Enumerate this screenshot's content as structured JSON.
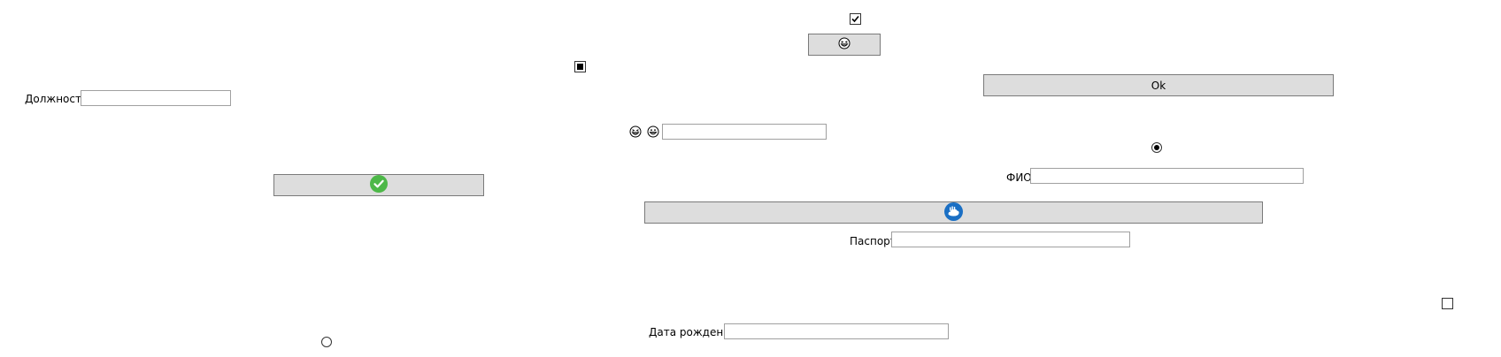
{
  "form": {
    "position_label": "Должность",
    "fio_label": "ФИО",
    "passport_label": "Паспорт",
    "birthdate_label": "Дата рождения",
    "ok_button_label": "Ok",
    "position_value": "",
    "fio_value": "",
    "passport_value": "",
    "birthdate_value": "",
    "emoji_field_value": ""
  },
  "controls": {
    "checkbox_top_checked": true,
    "checkbox_mid_state": "indeterminate",
    "checkbox_right_checked": false,
    "radio_right_selected": true,
    "radio_left_selected": false
  },
  "icons": {
    "emoji_button_icon": "grinning-squint-face-icon",
    "emoji_pair_left": "grinning-squint-face-icon",
    "emoji_pair_right": "grinning-face-icon",
    "check_button_icon": "check-circle-icon",
    "wide_button_icon": "cloud-badge-icon"
  },
  "colors": {
    "button_face": "#dddddd",
    "button_border": "#7a7a7a",
    "check_green": "#4db848",
    "badge_blue": "#1a6fc4"
  }
}
